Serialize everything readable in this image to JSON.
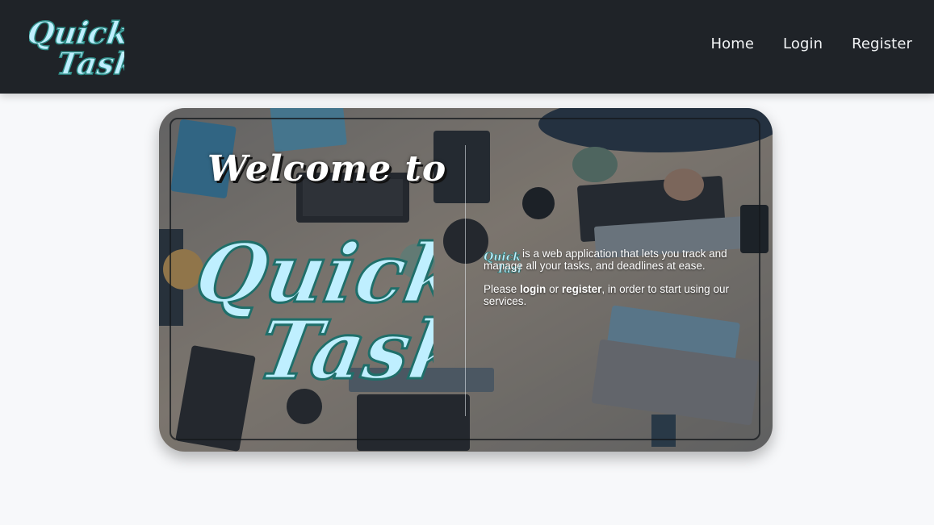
{
  "brand": {
    "logo_line1": "Quick",
    "logo_line2": "Task",
    "logo_color": "#bfefff",
    "logo_outline": "#2d8c86"
  },
  "nav": {
    "items": [
      {
        "label": "Home"
      },
      {
        "label": "Login"
      },
      {
        "label": "Register"
      }
    ]
  },
  "hero": {
    "welcome": "Welcome to",
    "big_logo_line1": "Quick",
    "big_logo_line2": "Task",
    "description_part1": "is a web application that lets you track and manage all your tasks, and deadlines at ease.",
    "cta_prefix": "Please",
    "cta_login": "login",
    "cta_or": "or",
    "cta_register": "register",
    "cta_suffix": ", in order to start using our services."
  },
  "colors": {
    "navbar_bg": "#1f2328",
    "page_bg": "#f7f8fa",
    "logo_fill": "#bfefff",
    "logo_stroke": "#2d8c86"
  }
}
